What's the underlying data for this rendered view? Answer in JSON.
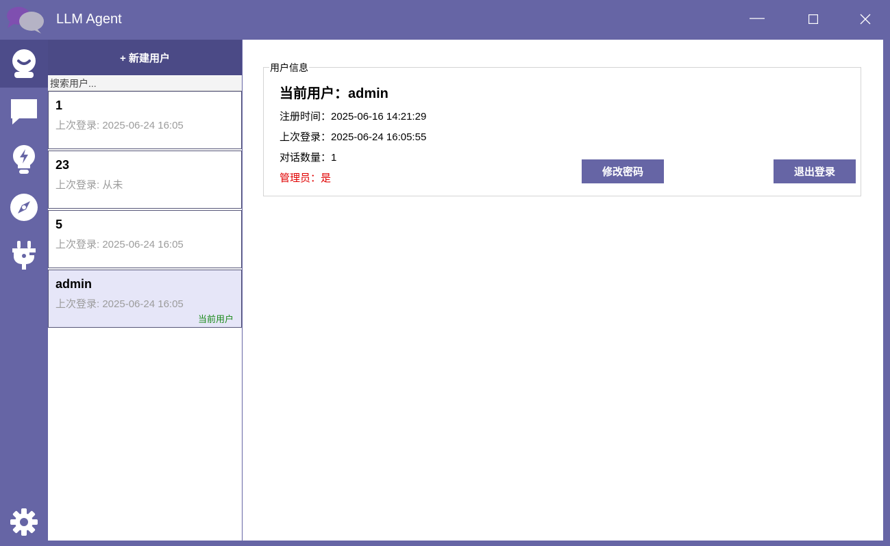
{
  "window": {
    "title": "LLM Agent",
    "logo_icon": "chat-bubbles-logo",
    "controls": [
      "minimize-icon",
      "maximize-icon",
      "close-icon"
    ]
  },
  "sidebar": {
    "items": [
      {
        "icon": "user-icon",
        "active": true
      },
      {
        "icon": "chat-icon",
        "active": false
      },
      {
        "icon": "lightbulb-icon",
        "active": false
      },
      {
        "icon": "compass-icon",
        "active": false
      },
      {
        "icon": "plug-icon",
        "active": false
      }
    ],
    "bottom_icon": "gear-icon"
  },
  "user_list": {
    "new_user_label": "+ 新建用户",
    "search_placeholder": "搜索用户...",
    "users": [
      {
        "name": "1",
        "last_login": "上次登录: 2025-06-24 16:05",
        "current": false
      },
      {
        "name": "23",
        "last_login": "上次登录: 从未",
        "current": false
      },
      {
        "name": "5",
        "last_login": "上次登录: 2025-06-24 16:05",
        "current": false
      },
      {
        "name": "admin",
        "last_login": "上次登录: 2025-06-24 16:05",
        "current": true,
        "current_tag": "当前用户"
      }
    ]
  },
  "user_info": {
    "group_title": "用户信息",
    "current_user": "当前用户：admin",
    "register_time": "注册时间：2025-06-16 14:21:29",
    "last_login": "上次登录：2025-06-24 16:05:55",
    "conversation_count": "对话数量：1",
    "is_admin": "管理员：是",
    "change_password_label": "修改密码",
    "logout_label": "退出登录"
  },
  "colors": {
    "brand": "#6665a5",
    "brand_dark": "#4b4a86",
    "current_highlight": "#e6e6f8",
    "current_tag": "#1a8a1a",
    "admin_text": "#e00000"
  }
}
